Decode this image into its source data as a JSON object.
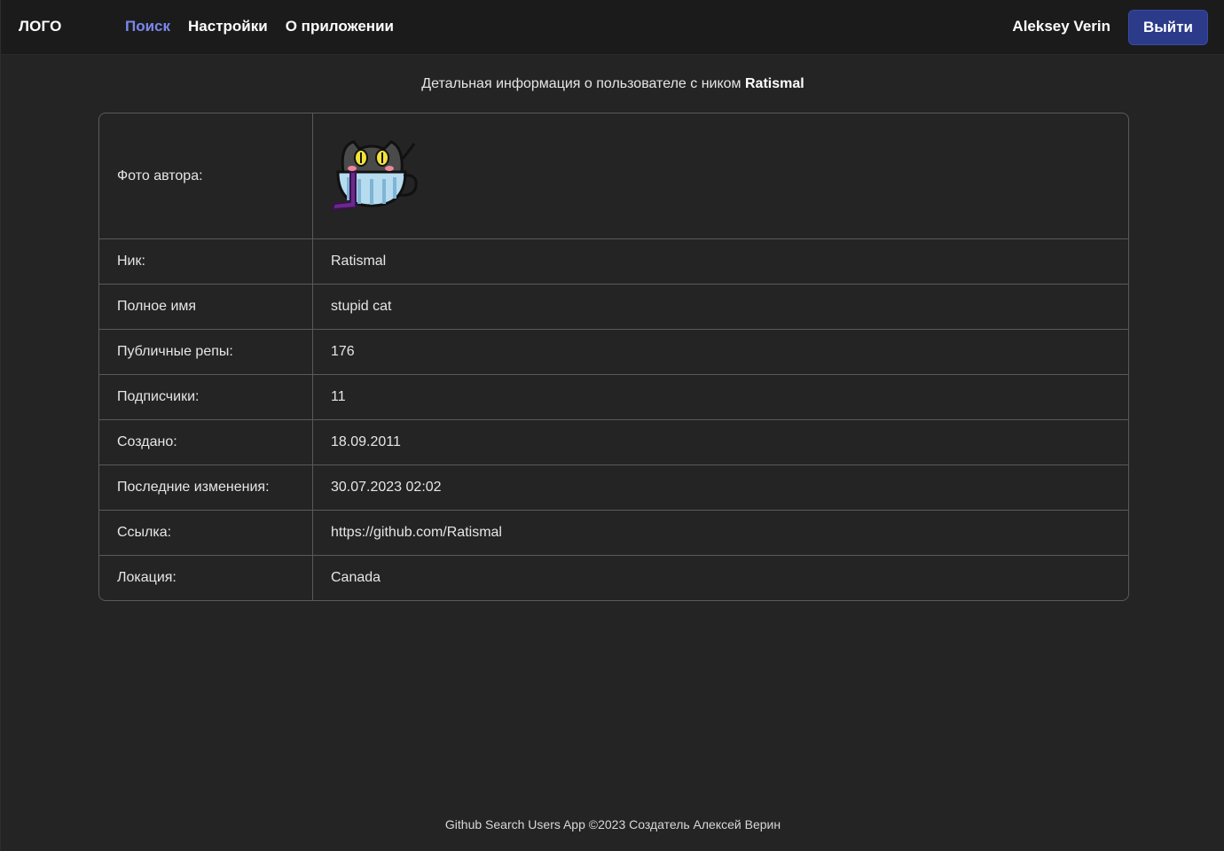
{
  "header": {
    "logo": "ЛОГО",
    "nav": [
      {
        "label": "Поиск",
        "active": true
      },
      {
        "label": "Настройки",
        "active": false
      },
      {
        "label": "О приложении",
        "active": false
      }
    ],
    "user_name": "Aleksey Verin",
    "logout_label": "Выйти"
  },
  "page": {
    "title_prefix": "Детальная информация о пользователе с ником",
    "title_nick": "Ratismal"
  },
  "details": {
    "photo_label": "Фото автора:",
    "rows": [
      {
        "label": "Ник:",
        "value": "Ratismal"
      },
      {
        "label": "Полное имя",
        "value": "stupid cat"
      },
      {
        "label": "Публичные репы:",
        "value": "176"
      },
      {
        "label": "Подписчики:",
        "value": "11"
      },
      {
        "label": "Создано:",
        "value": "18.09.2011"
      },
      {
        "label": "Последние изменения:",
        "value": "30.07.2023 02:02"
      },
      {
        "label": "Ссылка:",
        "value": "https://github.com/Ratismal"
      },
      {
        "label": "Локация:",
        "value": "Canada"
      }
    ]
  },
  "footer": {
    "text": "Github Search Users App ©2023 Создатель Алексей Верин"
  },
  "colors": {
    "background": "#242424",
    "header_bg": "#1b1b1b",
    "accent_nav": "#7b86ea",
    "button_bg": "#2b3b8a",
    "border": "#5a5a5a"
  }
}
